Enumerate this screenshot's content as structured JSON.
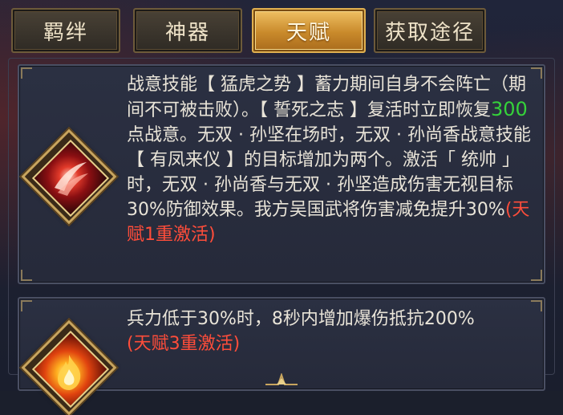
{
  "tabs": [
    {
      "label": "羁绊",
      "active": false
    },
    {
      "label": "神器",
      "active": false
    },
    {
      "label": "天赋",
      "active": true
    },
    {
      "label": "获取途径",
      "active": false
    }
  ],
  "talents": [
    {
      "icon": "red-slash-skill-icon",
      "text_before": "战意技能【 猛虎之势 】蓄力期间自身不会阵亡（期间不可被击败）。【 誓死之志 】复活时立即恢复",
      "highlight_value": "300",
      "text_after": "点战意。无双 · 孙坚在场时，无双 · 孙尚香战意技能【 有凤来仪 】的目标增加为两个。激活「 统帅 」时，无双 · 孙尚香与无双 · 孙坚造成伤害无视目标30%防御效果。我方吴国武将伤害减免提升30%",
      "activation": "(天赋1重激活)"
    },
    {
      "icon": "fire-skill-icon",
      "text_before": "兵力低于30%时，8秒内增加爆伤抵抗200%",
      "highlight_value": "",
      "text_after": "",
      "activation": "(天赋3重激活)"
    }
  ],
  "colors": {
    "highlight": "#35d23a",
    "activation": "#ff4d3a",
    "active_tab": "#e0b050"
  }
}
